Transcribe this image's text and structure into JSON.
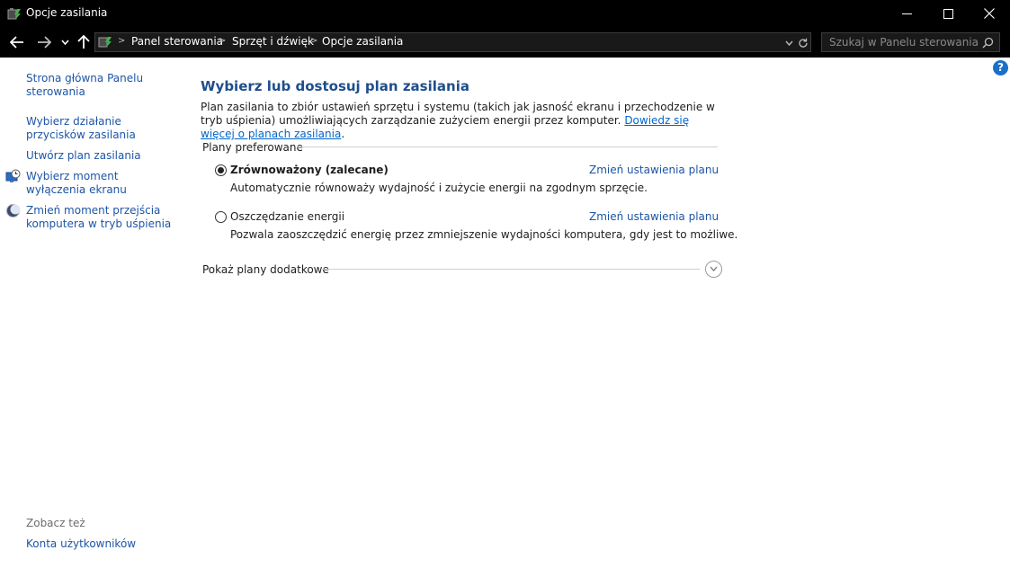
{
  "window": {
    "title": "Opcje zasilania"
  },
  "address": {
    "crumbs": [
      "Panel sterowania",
      "Sprzęt i dźwięk",
      "Opcje zasilania"
    ]
  },
  "search": {
    "placeholder": "Szukaj w Panelu sterowania"
  },
  "help": {
    "label": "?"
  },
  "sidebar": {
    "items": [
      {
        "label": "Strona główna Panelu sterowania"
      },
      {
        "label": "Wybierz działanie przycisków zasilania"
      },
      {
        "label": "Utwórz plan zasilania"
      },
      {
        "label": "Wybierz moment wyłączenia ekranu",
        "icon": "clock-monitor-icon"
      },
      {
        "label": "Zmień moment przejścia komputera w tryb uśpienia",
        "icon": "moon-sleep-icon"
      }
    ],
    "see_also_label": "Zobacz też",
    "see_also_items": [
      {
        "label": "Konta użytkowników"
      }
    ]
  },
  "main": {
    "heading": "Wybierz lub dostosuj plan zasilania",
    "description": "Plan zasilania to zbiór ustawień sprzętu i systemu (takich jak jasność ekranu i przechodzenie w tryb uśpienia) umożliwiających zarządzanie zużyciem energii przez komputer.",
    "learn_more_link": "Dowiedz się więcej o planach zasilania",
    "description_end": ".",
    "preferred_label": "Plany preferowane",
    "plans": [
      {
        "name": "Zrównoważony (zalecane)",
        "selected": true,
        "description": "Automatycznie równoważy wydajność i zużycie energii na zgodnym sprzęcie.",
        "link": "Zmień ustawienia planu"
      },
      {
        "name": "Oszczędzanie energii",
        "selected": false,
        "description": "Pozwala zaoszczędzić energię przez zmniejszenie wydajności komputera, gdy jest to możliwe.",
        "link": "Zmień ustawienia planu"
      }
    ],
    "show_more_label": "Pokaż plany dodatkowe"
  }
}
